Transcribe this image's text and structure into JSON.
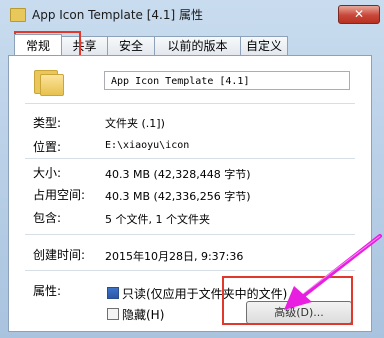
{
  "window": {
    "title": "App Icon Template [4.1] 属性",
    "close_glyph": "✕"
  },
  "tabs": [
    {
      "label": "常规",
      "active": true
    },
    {
      "label": "共享"
    },
    {
      "label": "安全"
    },
    {
      "label": "以前的版本"
    },
    {
      "label": "自定义"
    }
  ],
  "general": {
    "name": "App Icon Template [4.1]",
    "rows": [
      {
        "label": "类型:",
        "value": "文件夹 (.1])"
      },
      {
        "label": "位置:",
        "value": "E:\\xiaoyu\\icon"
      },
      {
        "label": "大小:",
        "value": "40.3 MB (42,328,448 字节)"
      },
      {
        "label": "占用空间:",
        "value": "40.3 MB (42,336,256 字节)"
      },
      {
        "label": "包含:",
        "value": "5 个文件, 1 个文件夹"
      },
      {
        "label": "创建时间:",
        "value": "2015年10月28日, 9:37:36"
      }
    ],
    "attributes": {
      "label": "属性:",
      "readonly_label": "只读(仅应用于文件夹中的文件)",
      "readonly_state": "mixed",
      "hidden_label": "隐藏(H)",
      "hidden_checked": false,
      "advanced_label": "高级(D)..."
    }
  },
  "colors": {
    "highlight": "#e0392b",
    "arrow": "#e81ee0"
  }
}
